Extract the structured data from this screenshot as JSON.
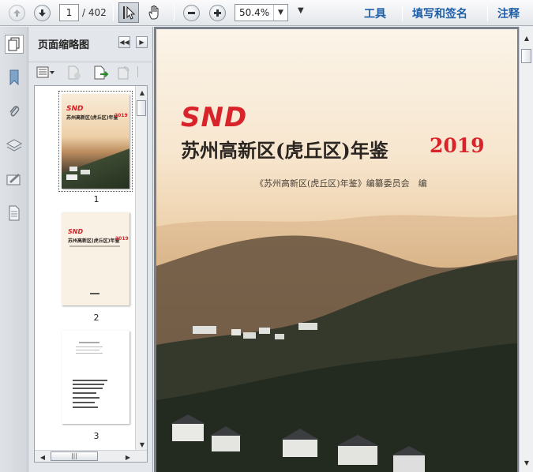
{
  "toolbar": {
    "current_page": "1",
    "total_pages": "/ 402",
    "zoom": "50.4%",
    "links": {
      "tools": "工具",
      "fill_sign": "填写和签名",
      "comment": "注释"
    },
    "icons": [
      "page-up-icon",
      "page-down-icon",
      "select-cursor-icon",
      "hand-tool-icon",
      "zoom-out-icon",
      "zoom-in-icon",
      "dropdown-arrow-icon"
    ]
  },
  "rail": {
    "icons": [
      "bookmark-icon",
      "attachment-icon",
      "layers-icon",
      "signature-icon",
      "page-icon"
    ]
  },
  "panel": {
    "title": "页面缩略图",
    "tool_icons": [
      "options-menu-icon",
      "delete-page-icon",
      "extract-page-icon",
      "rotate-icon",
      "more-icon"
    ],
    "thumbnails": [
      {
        "number": "1",
        "logo": "SND",
        "title": "苏州高新区(虎丘区)年鉴",
        "year": "2019"
      },
      {
        "number": "2",
        "logo": "SND",
        "title": "苏州高新区(虎丘区)年鉴",
        "year": "2019"
      },
      {
        "number": "3"
      }
    ]
  },
  "document": {
    "logo": "SND",
    "title": "苏州高新区(虎丘区)年鉴",
    "year": "2019",
    "editor": "《苏州高新区(虎丘区)年鉴》编纂委员会　编"
  },
  "colors": {
    "accent_red": "#d8232a",
    "link_blue": "#1f5fa8",
    "toolbar_bg": "#e3e6ea"
  }
}
